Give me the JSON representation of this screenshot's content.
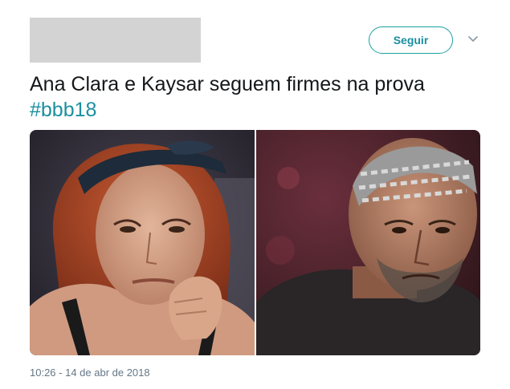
{
  "header": {
    "follow_label": "Seguir",
    "caret_icon": "chevron-down-icon"
  },
  "tweet": {
    "text": "Ana Clara e Kaysar seguem firmes na prova",
    "hashtag": "#bbb18",
    "timestamp": "10:26 - 14 de abr de 2018"
  },
  "media": {
    "images": [
      {
        "subject": "woman-with-bandana"
      },
      {
        "subject": "man-with-braided-hair"
      }
    ]
  },
  "colors": {
    "accent": "#1b8fa0",
    "text": "#14171a",
    "muted": "#657786",
    "redacted": "#d3d3d3"
  }
}
